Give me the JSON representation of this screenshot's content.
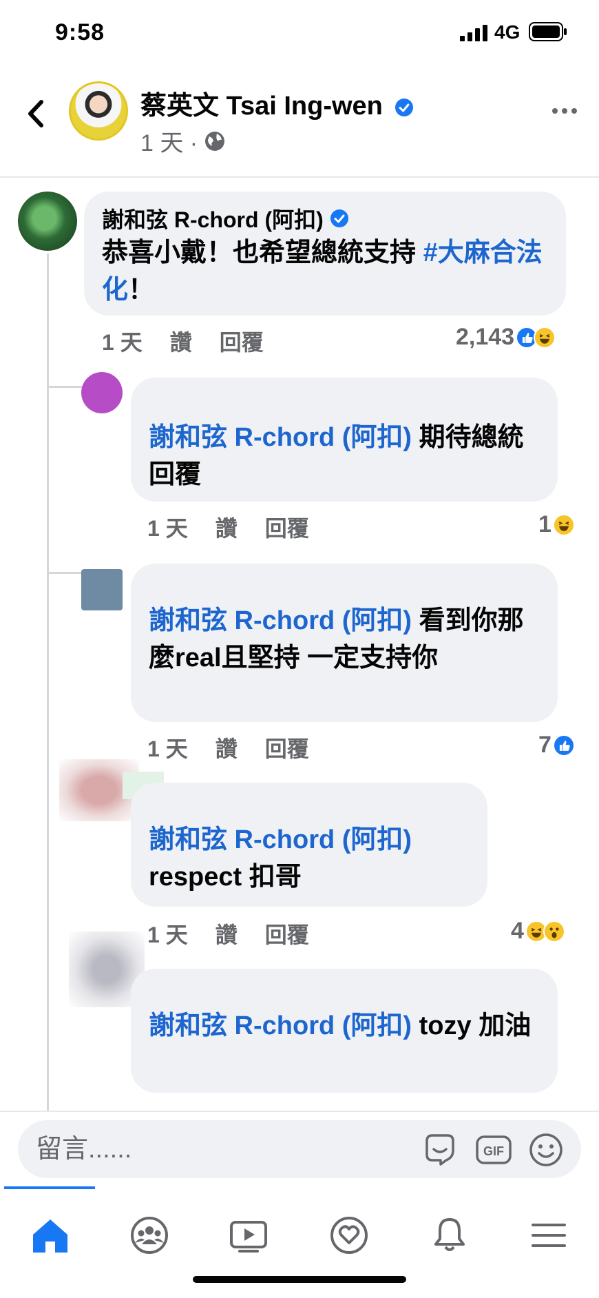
{
  "status_bar": {
    "time": "9:58",
    "network": "4G"
  },
  "header": {
    "page_name": "蔡英文 Tsai Ing-wen",
    "post_age": "1 天 ·"
  },
  "comments": [
    {
      "author": "謝和弦 R-chord (阿扣)",
      "text_before": "恭喜小戴！也希望總統支持 ",
      "hashtag": "#大麻合法化",
      "text_after": "！",
      "age": "1 天",
      "like_label": "讚",
      "reply_label": "回覆",
      "reaction_count": "2,143",
      "reactions": [
        "like",
        "haha"
      ]
    },
    {
      "mention": "謝和弦 R-chord (阿扣)",
      "text": " 期待總統回覆",
      "age": "1 天",
      "like_label": "讚",
      "reply_label": "回覆",
      "reaction_count": "1",
      "reactions": [
        "haha"
      ]
    },
    {
      "mention": "謝和弦 R-chord (阿扣)",
      "text": " 看到你那麼real且堅持 一定支持你",
      "age": "1 天",
      "like_label": "讚",
      "reply_label": "回覆",
      "reaction_count": "7",
      "reactions": [
        "like"
      ]
    },
    {
      "mention": "謝和弦 R-chord (阿扣)",
      "text": "respect 扣哥",
      "age": "1 天",
      "like_label": "讚",
      "reply_label": "回覆",
      "reaction_count": "4",
      "reactions": [
        "haha",
        "wow"
      ]
    },
    {
      "mention": "謝和弦 R-chord (阿扣)",
      "text": " tozy 加油"
    }
  ],
  "composer": {
    "placeholder": "留言......"
  },
  "colors": {
    "accent": "#1877f2",
    "link": "#1d66cf",
    "bubble": "#eff1f4",
    "muted": "#65676b"
  },
  "icons": {
    "nav": [
      "home-icon",
      "groups-icon",
      "watch-icon",
      "dating-icon",
      "notifications-icon",
      "menu-icon"
    ],
    "composer": [
      "sticker-icon",
      "gif-icon",
      "emoji-icon"
    ]
  }
}
